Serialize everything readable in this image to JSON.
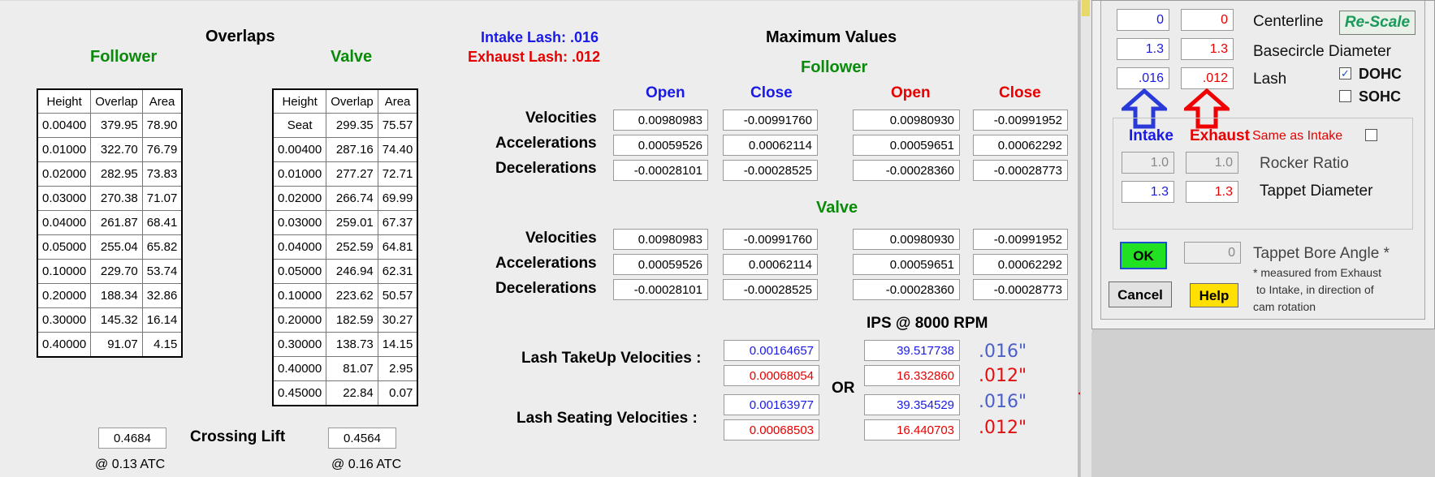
{
  "overlaps": {
    "title": "Overlaps",
    "follower_label": "Follower",
    "valve_label": "Valve",
    "headers": [
      "Height",
      "Overlap",
      "Area"
    ],
    "follower_rows": [
      [
        "0.00400",
        "379.95",
        "78.90"
      ],
      [
        "0.01000",
        "322.70",
        "76.79"
      ],
      [
        "0.02000",
        "282.95",
        "73.83"
      ],
      [
        "0.03000",
        "270.38",
        "71.07"
      ],
      [
        "0.04000",
        "261.87",
        "68.41"
      ],
      [
        "0.05000",
        "255.04",
        "65.82"
      ],
      [
        "0.10000",
        "229.70",
        "53.74"
      ],
      [
        "0.20000",
        "188.34",
        "32.86"
      ],
      [
        "0.30000",
        "145.32",
        "16.14"
      ],
      [
        "0.40000",
        "91.07",
        "4.15"
      ]
    ],
    "valve_rows": [
      [
        "Seat",
        "299.35",
        "75.57"
      ],
      [
        "0.00400",
        "287.16",
        "74.40"
      ],
      [
        "0.01000",
        "277.27",
        "72.71"
      ],
      [
        "0.02000",
        "266.74",
        "69.99"
      ],
      [
        "0.03000",
        "259.01",
        "67.37"
      ],
      [
        "0.04000",
        "252.59",
        "64.81"
      ],
      [
        "0.05000",
        "246.94",
        "62.31"
      ],
      [
        "0.10000",
        "223.62",
        "50.57"
      ],
      [
        "0.20000",
        "182.59",
        "30.27"
      ],
      [
        "0.30000",
        "138.73",
        "14.15"
      ],
      [
        "0.40000",
        "81.07",
        "2.95"
      ],
      [
        "0.45000",
        "22.84",
        "0.07"
      ]
    ],
    "crossing_label": "Crossing Lift",
    "crossing_follower": "0.4684",
    "crossing_valve": "0.4564",
    "atc_follower": "@ 0.13 ATC",
    "atc_valve": "@ 0.16 ATC"
  },
  "lash": {
    "intake": "Intake Lash: .016",
    "exhaust": "Exhaust Lash: .012"
  },
  "maximum": {
    "title": "Maximum Values",
    "follower_label": "Follower",
    "valve_label": "Valve",
    "col_open": "Open",
    "col_close": "Close",
    "row_labels": [
      "Velocities",
      "Accelerations",
      "Decelerations"
    ],
    "follower": [
      [
        "0.00980983",
        "-0.00991760",
        "0.00980930",
        "-0.00991952"
      ],
      [
        "0.00059526",
        "0.00062114",
        "0.00059651",
        "0.00062292"
      ],
      [
        "-0.00028101",
        "-0.00028525",
        "-0.00028360",
        "-0.00028773"
      ]
    ],
    "valve": [
      [
        "0.00980983",
        "-0.00991760",
        "0.00980930",
        "-0.00991952"
      ],
      [
        "0.00059526",
        "0.00062114",
        "0.00059651",
        "0.00062292"
      ],
      [
        "-0.00028101",
        "-0.00028525",
        "-0.00028360",
        "-0.00028773"
      ]
    ]
  },
  "velocities": {
    "ips_title": "IPS @ 8000 RPM",
    "takeup_label": "Lash TakeUp Velocities :",
    "seating_label": "Lash Seating Velocities :",
    "or_label": "OR",
    "takeup_intake": "0.00164657",
    "takeup_exhaust": "0.00068054",
    "seating_intake": "0.00163977",
    "seating_exhaust": "0.00068503",
    "takeup_ips_intake": "39.517738",
    "takeup_ips_exhaust": "16.332860",
    "seating_ips_intake": "39.354529",
    "seating_ips_exhaust": "16.440703",
    "note_016": ".016\"",
    "note_012": ".012\""
  },
  "dialog": {
    "centerline_label": "Centerline",
    "centerline_intake": "0",
    "centerline_exhaust": "0",
    "rescale_label": "Re-Scale",
    "basecircle_label": "Basecircle Diameter",
    "basecircle_intake": "1.3",
    "basecircle_exhaust": "1.3",
    "lash_label": "Lash",
    "lash_intake": ".016",
    "lash_exhaust": ".012",
    "dohc_label": "DOHC",
    "sohc_label": "SOHC",
    "intake_label": "Intake",
    "exhaust_label": "Exhaust",
    "same_as_intake_label": "Same as Intake",
    "rocker_label": "Rocker Ratio",
    "rocker_intake": "1.0",
    "rocker_exhaust": "1.0",
    "tappet_label": "Tappet Diameter",
    "tappet_intake": "1.3",
    "tappet_exhaust": "1.3",
    "ok_label": "OK",
    "cancel_label": "Cancel",
    "help_label": "Help",
    "bore_angle_value": "0",
    "bore_angle_label": "Tappet Bore Angle *",
    "note_line1": "* measured from Exhaust",
    "note_line2": " to Intake, in direction of",
    "note_line3": "cam rotation"
  },
  "colors": {
    "green": "#0a8a0a",
    "blue": "#1a1ae6",
    "red": "#e60000",
    "ok_button": "#22e022",
    "help_button": "#ffe000"
  }
}
